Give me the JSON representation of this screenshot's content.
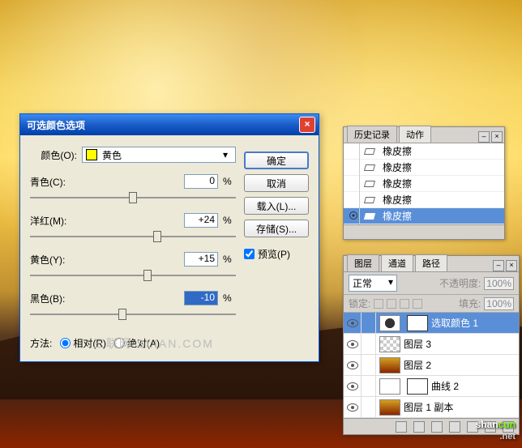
{
  "dialog": {
    "title": "可选颜色选项",
    "color_label": "颜色(O):",
    "color_value": "黄色",
    "sliders": [
      {
        "label": "青色(C):",
        "value": "0",
        "pos": 50
      },
      {
        "label": "洋红(M):",
        "value": "+24",
        "pos": 62
      },
      {
        "label": "黄色(Y):",
        "value": "+15",
        "pos": 57
      },
      {
        "label": "黑色(B):",
        "value": "-10",
        "pos": 45,
        "selected": true
      }
    ],
    "percent": "%",
    "method_label": "方法:",
    "method_rel": "相对(R)",
    "method_abs": "绝对(A)",
    "buttons": {
      "ok": "确定",
      "cancel": "取消",
      "load": "载入(L)...",
      "save": "存储(S)..."
    },
    "preview": "预览(P)",
    "watermark": "三联网 SLIAN.COM"
  },
  "history": {
    "tabs": [
      "历史记录",
      "动作"
    ],
    "items": [
      "橡皮擦",
      "橡皮擦",
      "橡皮擦",
      "橡皮擦",
      "橡皮擦"
    ]
  },
  "layers": {
    "tabs": [
      "图层",
      "通道",
      "路径"
    ],
    "blend": "正常",
    "opacity_label": "不透明度:",
    "opacity_val": "100%",
    "lock_label": "锁定:",
    "fill_label": "填充:",
    "fill_val": "100%",
    "items": [
      {
        "name": "选取颜色 1",
        "type": "adj",
        "selected": true,
        "mask": true
      },
      {
        "name": "图层 3",
        "type": "trans"
      },
      {
        "name": "图层 2",
        "type": "img"
      },
      {
        "name": "曲线 2",
        "type": "curve",
        "mask": true
      },
      {
        "name": "图层 1 副本",
        "type": "img"
      }
    ]
  },
  "logo": {
    "text1": "shan",
    "text2": "cun",
    "sub": ".net"
  }
}
